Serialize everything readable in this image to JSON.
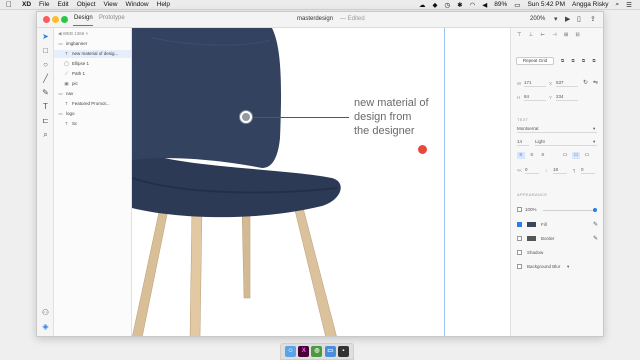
{
  "menubar": {
    "app_name": "XD",
    "items": [
      "File",
      "Edit",
      "Object",
      "View",
      "Window",
      "Help"
    ],
    "battery": "89%",
    "clock": "Sun 5:42 PM",
    "user": "Angga Risky"
  },
  "window": {
    "tabs": {
      "design": "Design",
      "prototype": "Prototype"
    },
    "doc_title": "masterdesign",
    "doc_status": "— Edited",
    "zoom": "200%"
  },
  "layers": {
    "breadcrumb": "◀ WEB 1366 ×",
    "items": [
      {
        "label": "imgbanner",
        "icon": "▭"
      },
      {
        "label": "new material of  desig...",
        "icon": "T"
      },
      {
        "label": "Ellipse 1",
        "icon": "◯"
      },
      {
        "label": "Path 1",
        "icon": "⟋"
      },
      {
        "label": "pic",
        "icon": "▣"
      },
      {
        "label": "nav",
        "icon": "▭"
      },
      {
        "label": "Featured      Promot...",
        "icon": "T"
      },
      {
        "label": "logo",
        "icon": "▭"
      },
      {
        "label": "Sc",
        "icon": "T"
      }
    ]
  },
  "canvas": {
    "headline_lines": [
      "new material of",
      "design from",
      "the designer"
    ]
  },
  "inspector": {
    "repeat_grid": "Repeat Grid",
    "w_label": "W",
    "w_value": "171",
    "h_label": "H",
    "h_value": "84",
    "x_label": "X",
    "x_value": "537",
    "y_label": "Y",
    "y_value": "234",
    "text_section": "TEXT",
    "font_family": "Montserrat",
    "font_size": "14",
    "font_weight": "Light",
    "char_spacing": "0",
    "line_spacing": "18",
    "para_spacing": "0",
    "appearance_section": "APPEARANCE",
    "opacity": "100%",
    "fill_label": "Fill",
    "border_label": "Border",
    "shadow_label": "Shadow",
    "blur_label": "Background Blur",
    "fill_color": "#3a4560",
    "border_color": "#555555"
  },
  "colors": {
    "accent": "#2680eb",
    "cursor_dot": "#e74a3b"
  }
}
